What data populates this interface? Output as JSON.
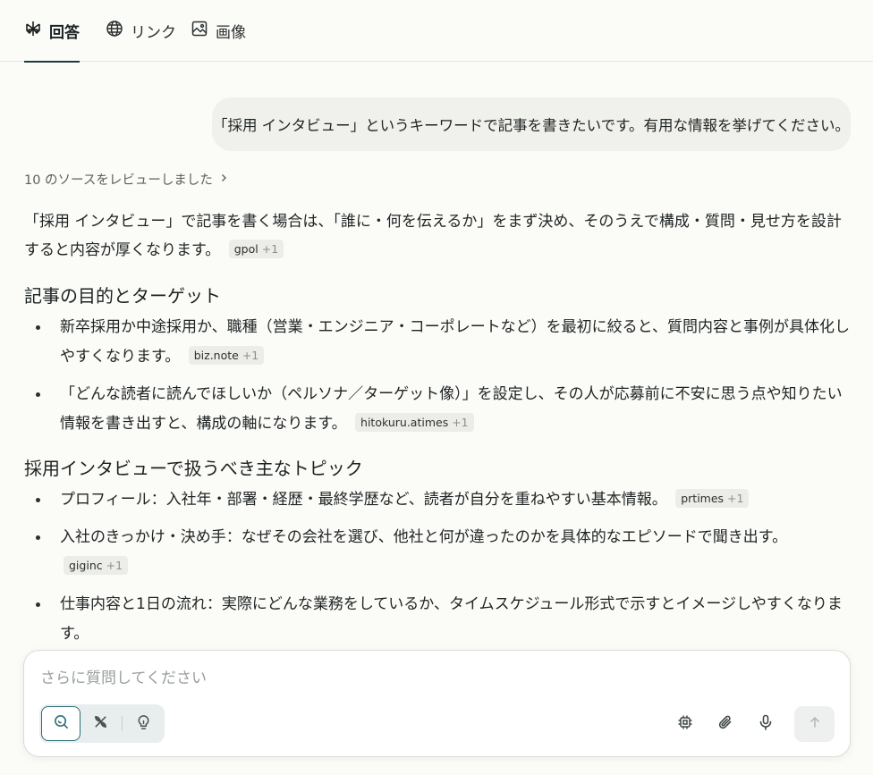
{
  "tabs": [
    {
      "label": "回答",
      "icon": "perplexity-logo-icon",
      "active": true
    },
    {
      "label": "リンク",
      "icon": "globe-icon",
      "active": false
    },
    {
      "label": "画像",
      "icon": "image-icon",
      "active": false
    }
  ],
  "user_message": "「採用 インタビュー」というキーワードで記事を書きたいです。有用な情報を挙げてください。",
  "sources_label": "10 のソースをレビューしました",
  "answer": {
    "intro": "「採用 インタビュー」で記事を書く場合は、「誰に・何を伝えるか」をまず決め、そのうえで構成・質問・見せ方を設計すると内容が厚くなります。",
    "intro_cite": {
      "source": "gpol",
      "extra": "+1"
    },
    "section1": {
      "heading": "記事の目的とターゲット",
      "items": [
        {
          "text": "新卒採用か中途採用か、職種（営業・エンジニア・コーポレートなど）を最初に絞ると、質問内容と事例が具体化しやすくなります。",
          "cite": "biz.note",
          "extra": "+1"
        },
        {
          "text": "「どんな読者に読んでほしいか（ペルソナ／ターゲット像）」を設定し、その人が応募前に不安に思う点や知りたい情報を書き出すと、構成の軸になります。",
          "cite": "hitokuru.atimes",
          "extra": "+1"
        }
      ]
    },
    "section2": {
      "heading": "採用インタビューで扱うべき主なトピック",
      "items": [
        {
          "text": "プロフィール：入社年・部署・経歴・最終学歴など、読者が自分を重ねやすい基本情報。",
          "cite": "prtimes",
          "extra": "+1"
        },
        {
          "text": "入社のきっかけ・決め手：なぜその会社を選び、他社と何が違ったのかを具体的なエピソードで聞き出す。",
          "cite": "giginc",
          "extra": "+1"
        },
        {
          "text": "仕事内容と1日の流れ：実際にどんな業務をしているか、タイムスケジュール形式で示すとイメージしやすくなります。",
          "cite": "",
          "extra": ""
        }
      ]
    }
  },
  "composer": {
    "placeholder": "さらに質問してください",
    "modes": [
      "search-icon",
      "research-icon",
      "lightbulb-icon"
    ],
    "tools": [
      "chip-icon",
      "paperclip-icon",
      "microphone-icon"
    ],
    "send_icon": "arrow-up-icon"
  }
}
